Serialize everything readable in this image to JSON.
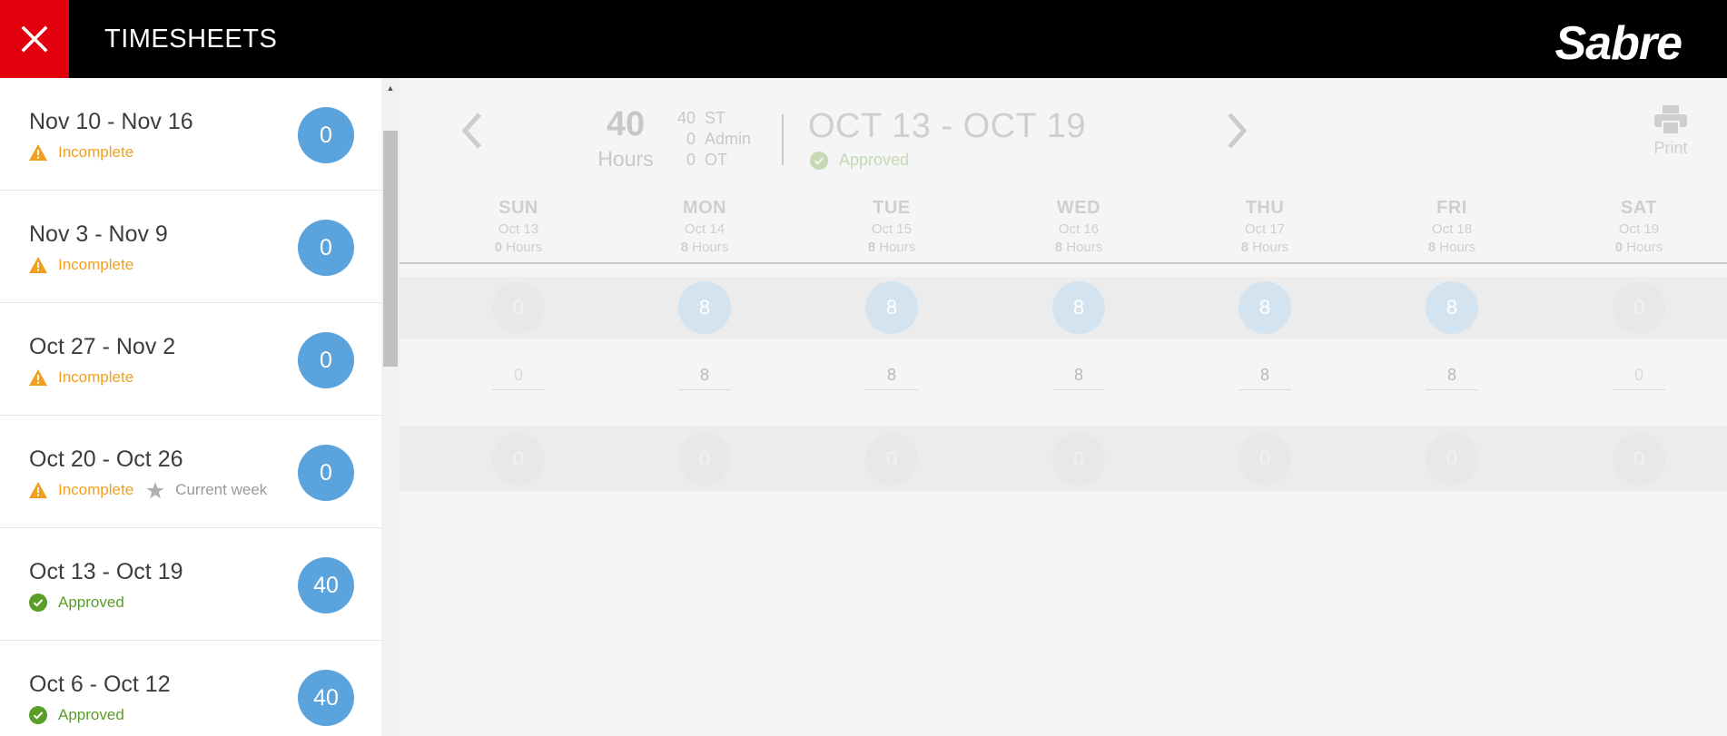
{
  "header": {
    "title": "TIMESHEETS",
    "logo": "Sabre",
    "close_icon": "close-icon"
  },
  "sidebar": {
    "weeks": [
      {
        "range": "Nov 10 - Nov 16",
        "status": "Incomplete",
        "status_type": "incomplete",
        "hours": "0",
        "extra": ""
      },
      {
        "range": "Nov 3 - Nov 9",
        "status": "Incomplete",
        "status_type": "incomplete",
        "hours": "0",
        "extra": ""
      },
      {
        "range": "Oct 27 - Nov 2",
        "status": "Incomplete",
        "status_type": "incomplete",
        "hours": "0",
        "extra": ""
      },
      {
        "range": "Oct 20 - Oct 26",
        "status": "Incomplete",
        "status_type": "incomplete",
        "hours": "0",
        "extra": "Current week"
      },
      {
        "range": "Oct 13 - Oct 19",
        "status": "Approved",
        "status_type": "approved",
        "hours": "40",
        "extra": ""
      },
      {
        "range": "Oct 6 - Oct 12",
        "status": "Approved",
        "status_type": "approved",
        "hours": "40",
        "extra": ""
      }
    ]
  },
  "summary": {
    "total": "40",
    "total_label": "Hours",
    "st_value": "40",
    "st_label": "ST",
    "admin_value": "0",
    "admin_label": "Admin",
    "ot_value": "0",
    "ot_label": "OT",
    "week_title": "OCT 13 - OCT 19",
    "week_status": "Approved",
    "print_label": "Print"
  },
  "days": [
    {
      "name": "SUN",
      "date": "Oct 13",
      "hours_num": "0",
      "hours_label": "Hours",
      "row1": "0",
      "row2": "0",
      "row3": "0"
    },
    {
      "name": "MON",
      "date": "Oct 14",
      "hours_num": "8",
      "hours_label": "Hours",
      "row1": "8",
      "row2": "8",
      "row3": "0"
    },
    {
      "name": "TUE",
      "date": "Oct 15",
      "hours_num": "8",
      "hours_label": "Hours",
      "row1": "8",
      "row2": "8",
      "row3": "0"
    },
    {
      "name": "WED",
      "date": "Oct 16",
      "hours_num": "8",
      "hours_label": "Hours",
      "row1": "8",
      "row2": "8",
      "row3": "0"
    },
    {
      "name": "THU",
      "date": "Oct 17",
      "hours_num": "8",
      "hours_label": "Hours",
      "row1": "8",
      "row2": "8",
      "row3": "0"
    },
    {
      "name": "FRI",
      "date": "Oct 18",
      "hours_num": "8",
      "hours_label": "Hours",
      "row1": "8",
      "row2": "8",
      "row3": "0"
    },
    {
      "name": "SAT",
      "date": "Oct 19",
      "hours_num": "0",
      "hours_label": "Hours",
      "row1": "0",
      "row2": "0",
      "row3": "0"
    }
  ],
  "colors": {
    "brand_red": "#e2000f",
    "badge_blue": "#5ba3dc",
    "incomplete": "#f0a020",
    "approved": "#5a9e2a"
  }
}
